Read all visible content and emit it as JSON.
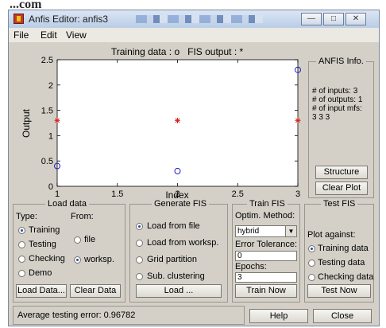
{
  "window": {
    "title": "Anfis Editor: anfis3"
  },
  "watermark": "...com",
  "menu": [
    "File",
    "Edit",
    "View"
  ],
  "plot": {
    "title": "Training data : o   FIS output : *"
  },
  "chart_data": {
    "type": "scatter",
    "title": "Training data : o   FIS output : *",
    "xlabel": "Index",
    "ylabel": "Output",
    "xlim": [
      1,
      3
    ],
    "ylim": [
      0,
      2.5
    ],
    "xticks": [
      "1",
      "1.5",
      "2",
      "2.5",
      "3"
    ],
    "yticks": [
      "0",
      "0.5",
      "1",
      "1.5",
      "2",
      "2.5"
    ],
    "grid": false,
    "series": [
      {
        "name": "Training data",
        "marker": "o",
        "color": "#1f1fbf",
        "x": [
          1,
          2,
          3
        ],
        "y": [
          0.4,
          0.3,
          2.3
        ]
      },
      {
        "name": "FIS output",
        "marker": "*",
        "color": "#d62020",
        "x": [
          1,
          2,
          3
        ],
        "y": [
          1.3,
          1.3,
          1.3
        ]
      }
    ]
  },
  "anfis_info": {
    "title": "ANFIS Info.",
    "inputs": "# of inputs: 3",
    "outputs": "# of outputs: 1",
    "mfs": "# of input mfs:",
    "mfs_value": "3 3 3",
    "structure_btn": "Structure",
    "clear_btn": "Clear Plot"
  },
  "load": {
    "title": "Load data",
    "type_label": "Type:",
    "from_label": "From:",
    "types": [
      "Training",
      "Testing",
      "Checking",
      "Demo"
    ],
    "from": [
      "file",
      "worksp."
    ],
    "load_btn": "Load Data...",
    "clear_btn": "Clear Data"
  },
  "generate": {
    "title": "Generate FIS",
    "options": [
      "Load from file",
      "Load from worksp.",
      "Grid partition",
      "Sub. clustering"
    ],
    "load_btn": "Load ..."
  },
  "train": {
    "title": "Train FIS",
    "method_label": "Optim. Method:",
    "method_value": "hybrid",
    "tol_label": "Error Tolerance:",
    "tol_value": "0",
    "epochs_label": "Epochs:",
    "epochs_value": "3",
    "train_btn": "Train Now"
  },
  "test": {
    "title": "Test FIS",
    "against_label": "Plot against:",
    "options": [
      "Training data",
      "Testing data",
      "Checking data"
    ],
    "test_btn": "Test Now"
  },
  "status": {
    "text": "Average testing error: 0.96782",
    "help_btn": "Help",
    "close_btn": "Close"
  }
}
